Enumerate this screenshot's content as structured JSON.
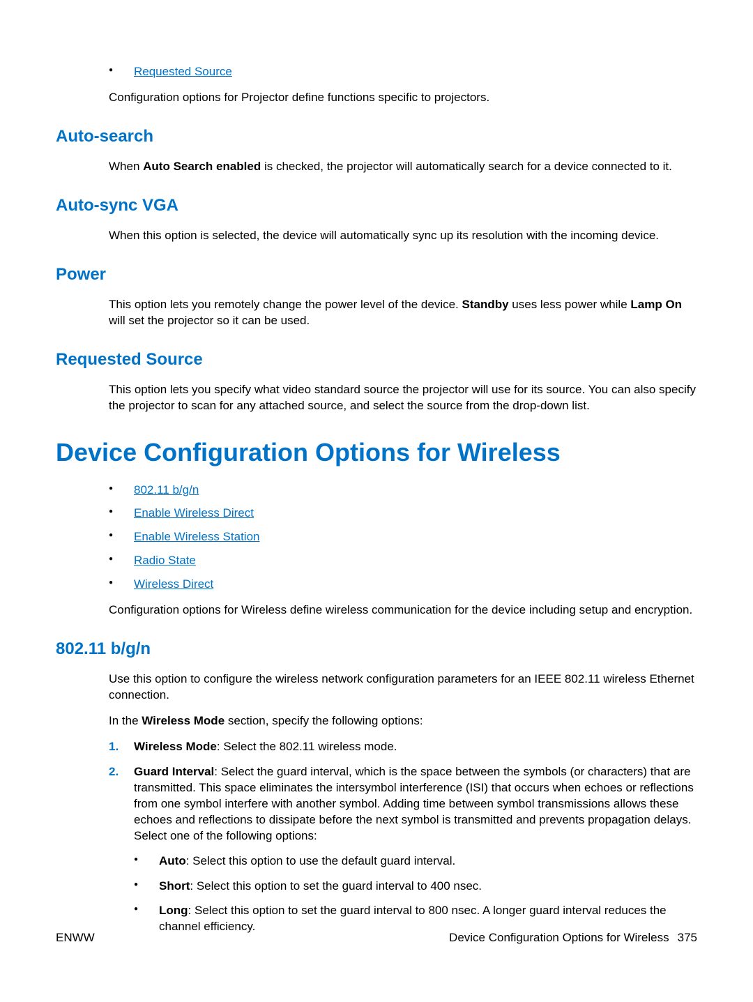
{
  "top_link": "Requested Source",
  "proj_config_desc": "Configuration options for Projector define functions specific to projectors.",
  "sections": {
    "auto_search": {
      "title": "Auto-search",
      "pre": "When ",
      "bold": "Auto Search enabled",
      "post": " is checked, the projector will automatically search for a device connected to it."
    },
    "auto_sync": {
      "title": "Auto-sync VGA",
      "text": "When this option is selected, the device will automatically sync up its resolution with the incoming device."
    },
    "power": {
      "title": "Power",
      "pre": "This option lets you remotely change the power level of the device. ",
      "b1": "Standby",
      "mid": " uses less power while ",
      "b2": "Lamp On",
      "post": " will set the projector so it can be used."
    },
    "req_source": {
      "title": "Requested Source",
      "text": "This option lets you specify what video standard source the projector will use for its source. You can also specify the projector to scan for any attached source, and select the source from the drop-down list."
    }
  },
  "h1": "Device Configuration Options for Wireless",
  "wireless_links": [
    "802.11 b/g/n",
    "Enable Wireless Direct",
    "Enable Wireless Station",
    "Radio State",
    "Wireless Direct"
  ],
  "wireless_desc": "Configuration options for Wireless define wireless communication for the device including setup and encryption.",
  "s80211": {
    "title": "802.11 b/g/n",
    "p1": "Use this option to configure the wireless network configuration parameters for an IEEE 802.11 wireless Ethernet connection.",
    "p2_pre": "In the ",
    "p2_bold": "Wireless Mode",
    "p2_post": " section, specify the following options:",
    "item1_bold": "Wireless Mode",
    "item1_text": ": Select the 802.11 wireless mode.",
    "item2_bold": "Guard Interval",
    "item2_text": ": Select the guard interval, which is the space between the symbols (or characters) that are transmitted. This space eliminates the intersymbol interference (ISI) that occurs when echoes or reflections from one symbol interfere with another symbol. Adding time between symbol transmissions allows these echoes and reflections to dissipate before the next symbol is transmitted and prevents propagation delays. Select one of the following options:",
    "sub": {
      "auto_b": "Auto",
      "auto_t": ": Select this option to use the default guard interval.",
      "short_b": "Short",
      "short_t": ": Select this option to set the guard interval to 400 nsec.",
      "long_b": "Long",
      "long_t": ": Select this option to set the guard interval to 800 nsec. A longer guard interval reduces the channel efficiency."
    }
  },
  "footer": {
    "left": "ENWW",
    "right_text": "Device Configuration Options for Wireless",
    "page": "375"
  }
}
